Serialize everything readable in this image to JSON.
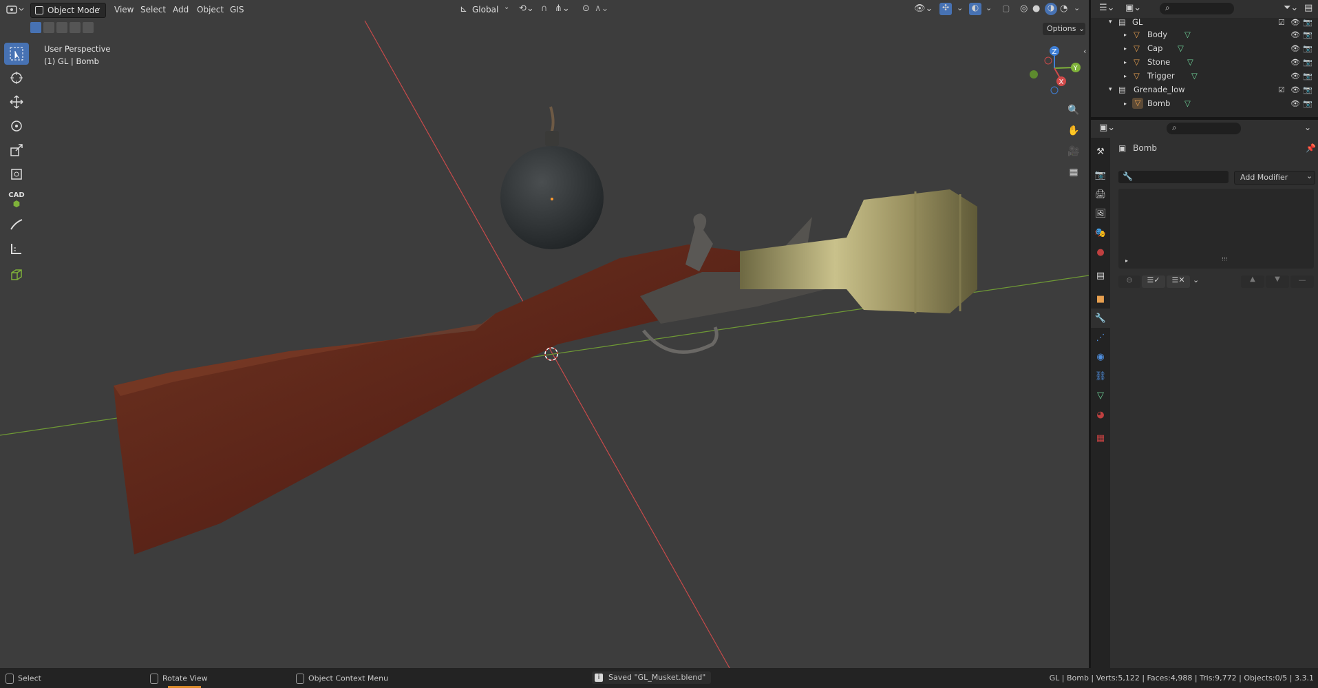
{
  "header": {
    "mode_label": "Object Mode",
    "menus": [
      "View",
      "Select",
      "Add",
      "Object",
      "GIS"
    ],
    "orientation_label": "Global",
    "options_label": "Options"
  },
  "viewport": {
    "perspective_label": "User Perspective",
    "context_label": "(1) GL | Bomb",
    "gizmo_axes": {
      "x": "X",
      "y": "Y",
      "z": "Z"
    },
    "colors": {
      "x_axis": "#d14a4a",
      "y_axis": "#7fb23a",
      "z_axis": "#3f7fd6",
      "active_tool": "#4772b3"
    }
  },
  "toolbar": {
    "tools": [
      "select-box",
      "cursor",
      "move",
      "rotate",
      "scale",
      "transform",
      "cad-transform",
      "annotate",
      "measure",
      "add-cube"
    ],
    "cad_label": "CAD"
  },
  "outliner": {
    "rows": [
      {
        "name": "GL",
        "indent": 0,
        "type": "collection"
      },
      {
        "name": "Body",
        "indent": 1,
        "type": "mesh"
      },
      {
        "name": "Cap",
        "indent": 1,
        "type": "mesh"
      },
      {
        "name": "Stone",
        "indent": 1,
        "type": "mesh"
      },
      {
        "name": "Trigger",
        "indent": 1,
        "type": "mesh"
      },
      {
        "name": "Grenade_low",
        "indent": 0,
        "type": "collection"
      },
      {
        "name": "Bomb",
        "indent": 1,
        "type": "mesh"
      }
    ]
  },
  "properties": {
    "object_name": "Bomb",
    "add_modifier_label": "Add Modifier"
  },
  "statusbar": {
    "select_label": "Select",
    "rotate_label": "Rotate View",
    "context_menu_label": "Object Context Menu",
    "saved_message": "Saved \"GL_Musket.blend\"",
    "stats": "GL | Bomb | Verts:5,122 | Faces:4,988 | Tris:9,772 | Objects:0/5 | 3.3.1"
  }
}
